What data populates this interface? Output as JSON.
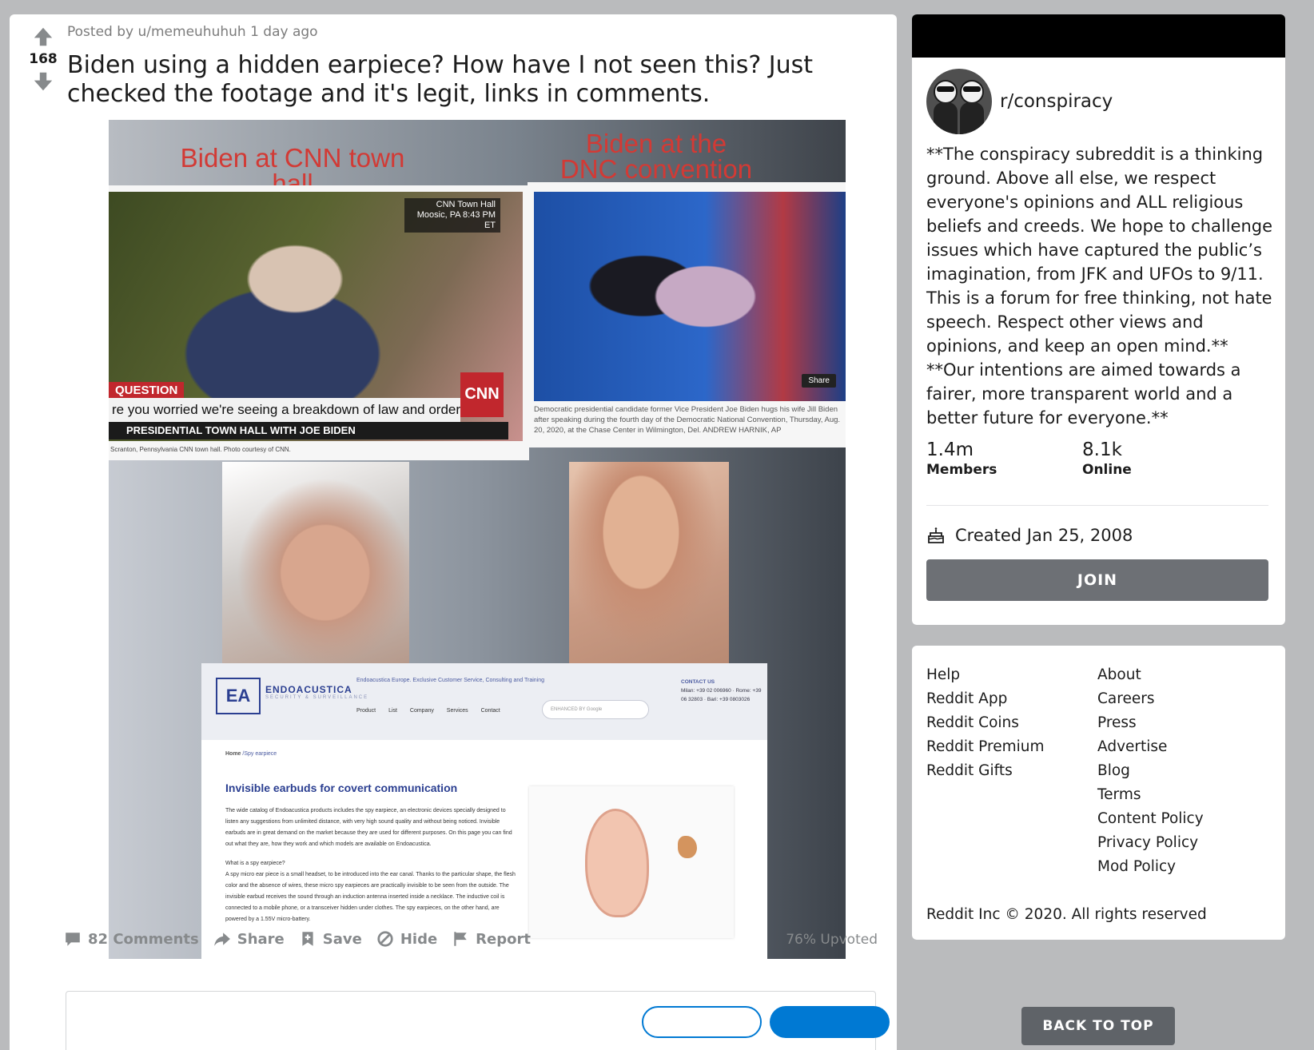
{
  "post": {
    "vote_count": "168",
    "meta_prefix": "Posted by ",
    "author": "u/memeuhuhuh",
    "time": " 1 day ago",
    "title": "Biden using a hidden earpiece? How have I not seen this? Just checked the footage and it's legit, links in comments.",
    "image": {
      "caption_left": "Biden at CNN town hall",
      "caption_right": "Biden at the DNC convention",
      "cnn_tag": "CNN Town Hall Moosic, PA 8:43 PM ET",
      "cnn_question": "QUESTION",
      "cnn_ticker": "re you worried we're seeing a breakdown of law and order in this country?",
      "cnn_live": "CNN",
      "cnn_bottom": "PRESIDENTIAL TOWN HALL WITH JOE BIDEN",
      "cnn_credit": "Scranton, Pennsylvania CNN town hall. Photo courtesy of CNN.",
      "dnc_share": "Share",
      "dnc_caption": "Democratic presidential candidate former Vice President Joe Biden hugs his wife Jill Biden after speaking during the fourth day of the Democratic National Convention, Thursday, Aug. 20, 2020, at the Chase Center in Wilmington, Del. ANDREW HARNIK, AP",
      "site_brand": "ENDOACUSTICA",
      "site_brand_sub": "SECURITY & SURVEILLANCE",
      "site_tagline": "Endoacustica Europe. Exclusive Customer Service, Consulting and Training",
      "site_menu": "Product List Company Services Contact",
      "site_search": "ENHANCED BY Google",
      "site_contact_title": "CONTACT US",
      "site_contact_lines": "Milan: +39 02 006960 · Rome: +39 06 32803 · Bari: +39 0803026",
      "site_breadcrumb_home": "Home",
      "site_breadcrumb_page": " /Spy earpiece",
      "site_heading": "Invisible earbuds for covert communication",
      "site_paragraph": "The wide catalog of Endoacustica products includes the spy earpiece, an electronic devices specially designed to listen any suggestions from unlimited distance, with very high sound quality and without being noticed. Invisible earbuds are in great demand on the market because they are used for different purposes. On this page you can find out what they are, how they work and which models are available on Endoacustica.",
      "site_subheading": "What is a spy earpiece?",
      "site_paragraph2": "A spy micro ear piece is a small headset, to be introduced into the ear canal. Thanks to the particular shape, the flesh color and the absence of wires, these micro spy earpieces are practically invisible to be seen from the outside. The invisible earbud receives the sound through an induction antenna inserted inside a necklace. The inductive coil is connected to a mobile phone, or a transceiver hidden under clothes. The spy earpieces, on the other hand, are powered by a 1.55V micro-battery."
    },
    "actions": {
      "comments": "82 Comments",
      "share": "Share",
      "save": "Save",
      "hide": "Hide",
      "report": "Report"
    },
    "upvoted": "76% Upvoted"
  },
  "sidebar": {
    "subreddit": "r/conspiracy",
    "description": "**The conspiracy subreddit is a thinking ground. Above all else, we respect everyone's opinions and ALL religious beliefs and creeds. We hope to challenge issues which have captured the public’s imagination, from JFK and UFOs to 9/11. This is a forum for free thinking, not hate speech. Respect other views and opinions, and keep an open mind.** **Our intentions are aimed towards a fairer, more transparent world and a better future for everyone.**",
    "members_count": "1.4m",
    "members_label": "Members",
    "online_count": "8.1k",
    "online_label": "Online",
    "created": "Created Jan 25, 2008",
    "join_label": "JOIN"
  },
  "footer_links": {
    "left": [
      "Help",
      "Reddit App",
      "Reddit Coins",
      "Reddit Premium",
      "Reddit Gifts"
    ],
    "right": [
      "About",
      "Careers",
      "Press",
      "Advertise",
      "Blog",
      "Terms",
      "Content Policy",
      "Privacy Policy",
      "Mod Policy"
    ],
    "copyright": "Reddit Inc © 2020. All rights reserved"
  },
  "back_to_top": "BACK TO TOP",
  "colors": {
    "page_bg": "#babbbd",
    "caption_red": "#d23a35",
    "join_button": "#6d7075",
    "link_blue": "#0079d3"
  },
  "icons": [
    "upvote-icon",
    "downvote-icon",
    "comment-icon",
    "share-icon",
    "save-icon",
    "hide-icon",
    "report-icon",
    "cake-icon"
  ]
}
